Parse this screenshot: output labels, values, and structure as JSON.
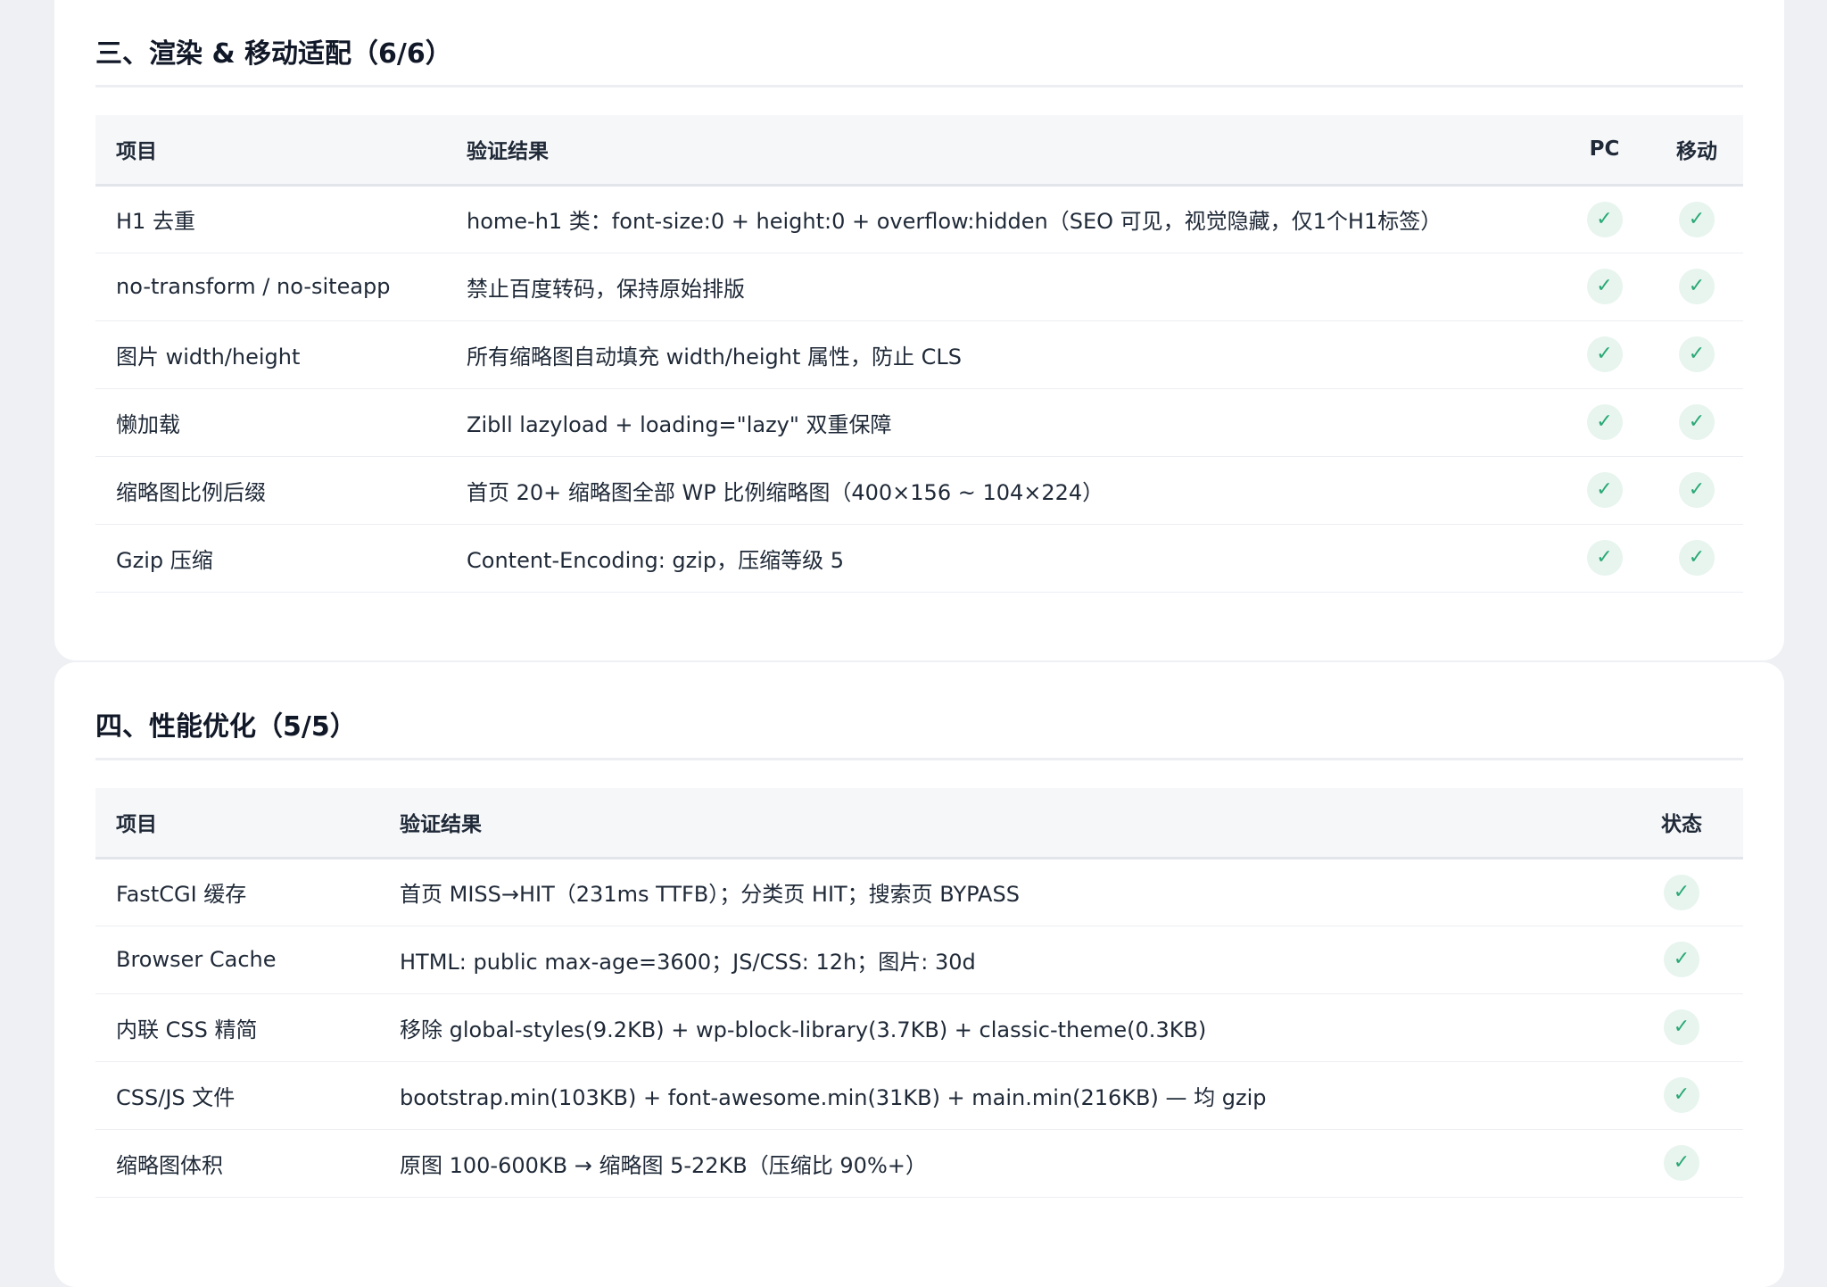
{
  "render_section": {
    "title": "三、渲染 & 移动适配（6/6）",
    "headers": {
      "item": "项目",
      "result": "验证结果",
      "pc": "PC",
      "mobile": "移动"
    },
    "rows": [
      {
        "item": "H1 去重",
        "result": "home-h1 类：font-size:0 + height:0 + overflow:hidden（SEO 可见，视觉隐藏，仅1个H1标签）",
        "pc": "✓",
        "mobile": "✓"
      },
      {
        "item": "no-transform / no-siteapp",
        "result": "禁止百度转码，保持原始排版",
        "pc": "✓",
        "mobile": "✓"
      },
      {
        "item": "图片 width/height",
        "result": "所有缩略图自动填充 width/height 属性，防止 CLS",
        "pc": "✓",
        "mobile": "✓"
      },
      {
        "item": "懒加载",
        "result": "Zibll lazyload + loading=\"lazy\" 双重保障",
        "pc": "✓",
        "mobile": "✓"
      },
      {
        "item": "缩略图比例后缀",
        "result": "首页 20+ 缩略图全部 WP 比例缩略图（400×156 ~ 104×224）",
        "pc": "✓",
        "mobile": "✓"
      },
      {
        "item": "Gzip 压缩",
        "result": "Content-Encoding: gzip，压缩等级 5",
        "pc": "✓",
        "mobile": "✓"
      }
    ]
  },
  "perf_section": {
    "title": "四、性能优化（5/5）",
    "headers": {
      "item": "项目",
      "result": "验证结果",
      "status": "状态"
    },
    "rows": [
      {
        "item": "FastCGI 缓存",
        "result": "首页 MISS→HIT（231ms TTFB）；分类页 HIT；搜索页 BYPASS",
        "status": "✓"
      },
      {
        "item": "Browser Cache",
        "result": "HTML: public max-age=3600；JS/CSS: 12h；图片: 30d",
        "status": "✓"
      },
      {
        "item": "内联 CSS 精简",
        "result": "移除 global-styles(9.2KB) + wp-block-library(3.7KB) + classic-theme(0.3KB)",
        "status": "✓"
      },
      {
        "item": "CSS/JS 文件",
        "result": "bootstrap.min(103KB) + font-awesome.min(31KB) + main.min(216KB) — 均 gzip",
        "status": "✓"
      },
      {
        "item": "缩略图体积",
        "result": "原图 100-600KB → 缩略图 5-22KB（压缩比 90%+）",
        "status": "✓"
      }
    ]
  },
  "colors": {
    "page_bg": "#eef0f4",
    "card_bg": "#ffffff",
    "check_bg": "#e7f5ee",
    "check_fg": "#2aa876"
  },
  "icons": {
    "check": "check-icon"
  }
}
